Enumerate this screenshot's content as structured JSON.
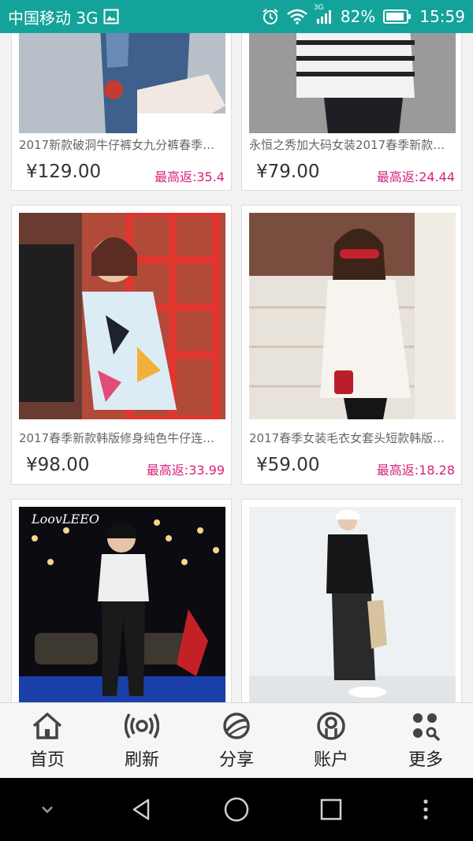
{
  "status_bar": {
    "carrier": "中国移动 3G",
    "network_badge": "3G",
    "battery": "82%",
    "time": "15:59"
  },
  "products": [
    {
      "title": "2017新款破洞牛仔裤女九分裤春季…",
      "price": "¥129.00",
      "rebate": "最高返:35.4"
    },
    {
      "title": "永恒之秀加大码女装2017春季新款…",
      "price": "¥79.00",
      "rebate": "最高返:24.44"
    },
    {
      "title": "2017春季新款韩版修身纯色牛仔连…",
      "price": "¥98.00",
      "rebate": "最高返:33.99"
    },
    {
      "title": "2017春季女装毛衣女套头短款韩版…",
      "price": "¥59.00",
      "rebate": "最高返:18.28"
    },
    {
      "title": "",
      "price": "",
      "rebate": ""
    },
    {
      "title": "",
      "price": "",
      "rebate": ""
    }
  ],
  "photo_logo_text": "LoovLEEO",
  "tabbar": {
    "items": [
      {
        "label": "首页",
        "icon": "home-icon"
      },
      {
        "label": "刷新",
        "icon": "refresh-broadcast-icon"
      },
      {
        "label": "分享",
        "icon": "planet-share-icon"
      },
      {
        "label": "账户",
        "icon": "account-icon"
      },
      {
        "label": "更多",
        "icon": "more-grid-icon"
      }
    ]
  },
  "colors": {
    "status_bar": "#14a39a",
    "rebate_text": "#d6227a",
    "price_text": "#333333"
  }
}
